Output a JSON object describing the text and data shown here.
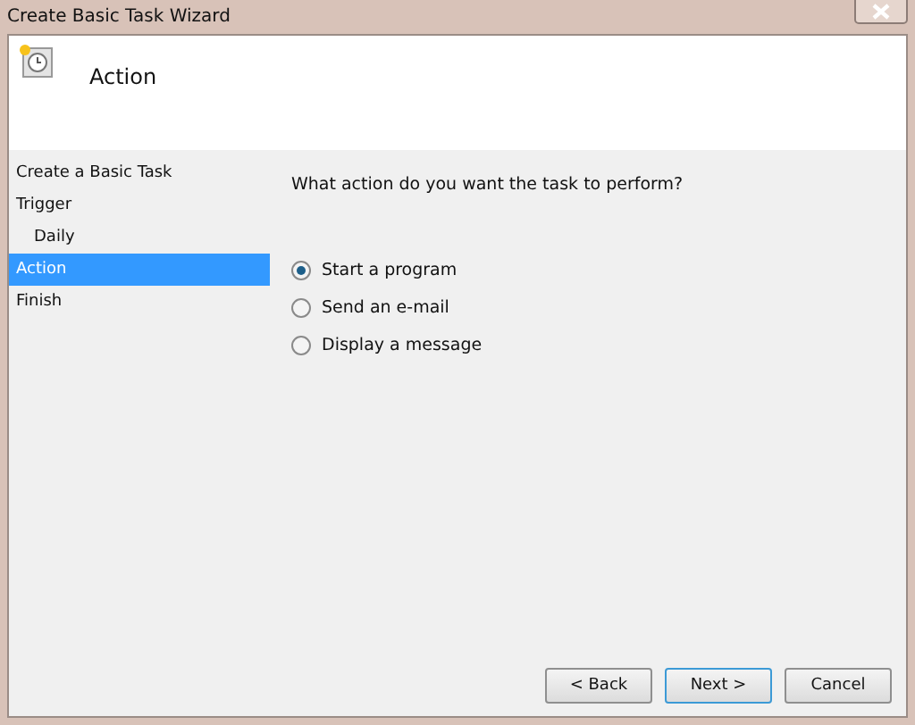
{
  "window": {
    "title": "Create Basic Task Wizard"
  },
  "header": {
    "title": "Action"
  },
  "steps": [
    {
      "label": "Create a Basic Task",
      "selected": false
    },
    {
      "label": "Trigger",
      "selected": false,
      "children": [
        {
          "label": "Daily",
          "selected": false
        }
      ]
    },
    {
      "label": "Action",
      "selected": true
    },
    {
      "label": "Finish",
      "selected": false
    }
  ],
  "question": "What action do you want the task to perform?",
  "options": [
    {
      "label": "Start a program",
      "selected": true
    },
    {
      "label": "Send an e-mail",
      "selected": false
    },
    {
      "label": "Display a message",
      "selected": false
    }
  ],
  "buttons": [
    {
      "label": "< Back",
      "focused": false
    },
    {
      "label": "Next >",
      "focused": true
    },
    {
      "label": "Cancel",
      "focused": false
    }
  ]
}
